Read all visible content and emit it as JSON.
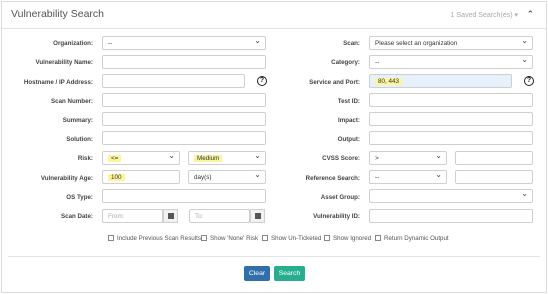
{
  "header": {
    "title": "Vulnerability Search",
    "saved_searches": "1 Saved Search(es) ▾"
  },
  "left": {
    "organization_label": "Organization:",
    "organization_value": "--",
    "vuln_name_label": "Vulnerability Name:",
    "hostname_label": "Hostname / IP Address:",
    "scan_number_label": "Scan Number:",
    "summary_label": "Summary:",
    "solution_label": "Solution:",
    "risk_label": "Risk:",
    "risk_operator": "<=",
    "risk_value": "Medium",
    "age_label": "Vulnerability Age:",
    "age_value": "100",
    "age_unit": "day(s)",
    "os_label": "OS Type:",
    "scan_date_label": "Scan Date:",
    "from_placeholder": "From:",
    "to_placeholder": "To:"
  },
  "right": {
    "scan_label": "Scan:",
    "scan_value": "Please select an organization",
    "category_label": "Category:",
    "category_value": "--",
    "service_label": "Service and Port:",
    "service_value": "80, 443",
    "test_id_label": "Test ID:",
    "impact_label": "Impact:",
    "output_label": "Output:",
    "cvss_label": "CVSS Score:",
    "cvss_operator": ">",
    "reference_label": "Reference Search:",
    "reference_value": "--",
    "asset_group_label": "Asset Group:",
    "vuln_id_label": "Vulnerability ID:"
  },
  "options": {
    "previous_results": "Include Previous Scan Results",
    "show_none_risk": "Show 'None' Risk",
    "show_unticketed": "Show Un-Ticketed",
    "show_ignored": "Show Ignored",
    "dynamic_output": "Return Dynamic Output"
  },
  "buttons": {
    "clear": "Clear",
    "search": "Search"
  },
  "colors": {
    "clear_button": "#2f6fab",
    "search_button": "#27ae8f",
    "highlight": "#fbf59b"
  }
}
